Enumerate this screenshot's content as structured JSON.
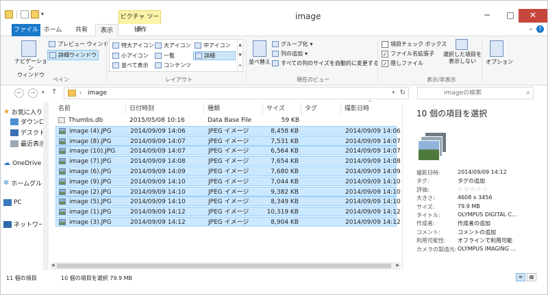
{
  "window": {
    "title": "image",
    "context_tab": "ピクチャ ツール"
  },
  "tabs": {
    "file": "ファイル",
    "home": "ホーム",
    "share": "共有",
    "view": "表示",
    "operate": "操作"
  },
  "ribbon": {
    "pane": {
      "nav_pane": "ナビゲーション\nウィンドウ",
      "preview": "プレビュー ウィンドウ",
      "details": "詳細ウィンドウ",
      "group": "ペイン"
    },
    "layout": {
      "xl_icons": "特大アイコン",
      "l_icons": "大アイコン",
      "m_icons": "中アイコン",
      "s_icons": "小アイコン",
      "list": "一覧",
      "details": "詳細",
      "tiles": "並べて表示",
      "content": "コンテンツ",
      "group": "レイアウト"
    },
    "current_view": {
      "sort": "並べ替え",
      "group_by": "グループ化",
      "add_columns": "列の追加",
      "size_all": "すべての列のサイズを自動的に変更する",
      "group": "現在のビュー"
    },
    "show_hide": {
      "item_checkboxes": "項目チェック ボックス",
      "extensions": "ファイル名拡張子",
      "hidden_items": "隠しファイル",
      "hide_selected": "選択した項目を\n表示しない",
      "group": "表示/非表示"
    },
    "options": "オプション"
  },
  "address": {
    "path": "image",
    "search_placeholder": "imageの検索"
  },
  "nav": {
    "items": [
      {
        "label": "お気に入り"
      },
      {
        "label": "ダウンロード"
      },
      {
        "label": "デスクトップ"
      },
      {
        "label": "最近表示した場所"
      },
      {
        "label": "OneDrive"
      },
      {
        "label": "ホームグループ"
      },
      {
        "label": "PC"
      },
      {
        "label": "ネットワーク"
      }
    ]
  },
  "columns": {
    "name": "名前",
    "date": "日付時刻",
    "type": "種類",
    "size": "サイズ",
    "tag": "タグ",
    "taken": "撮影日時"
  },
  "files": [
    {
      "name": "Thumbs.db",
      "date": "2015/05/08 10:16",
      "type": "Data Base File",
      "size": "59 KB",
      "taken": "",
      "selected": false
    },
    {
      "name": "image (4).JPG",
      "date": "2014/09/09 14:06",
      "type": "JPEG イメージ",
      "size": "8,458 KB",
      "taken": "2014/09/09 14:06",
      "selected": true
    },
    {
      "name": "image (8).JPG",
      "date": "2014/09/09 14:07",
      "type": "JPEG イメージ",
      "size": "7,531 KB",
      "taken": "2014/09/09 14:07",
      "selected": true
    },
    {
      "name": "image (10).JPG",
      "date": "2014/09/09 14:07",
      "type": "JPEG イメージ",
      "size": "6,564 KB",
      "taken": "2014/09/09 14:07",
      "selected": true
    },
    {
      "name": "image (7).JPG",
      "date": "2014/09/09 14:08",
      "type": "JPEG イメージ",
      "size": "7,654 KB",
      "taken": "2014/09/09 14:08",
      "selected": true
    },
    {
      "name": "image (6).JPG",
      "date": "2014/09/09 14:09",
      "type": "JPEG イメージ",
      "size": "7,680 KB",
      "taken": "2014/09/09 14:09",
      "selected": true
    },
    {
      "name": "image (9).JPG",
      "date": "2014/09/09 14:10",
      "type": "JPEG イメージ",
      "size": "7,044 KB",
      "taken": "2014/09/09 14:10",
      "selected": true
    },
    {
      "name": "image (2).JPG",
      "date": "2014/09/09 14:10",
      "type": "JPEG イメージ",
      "size": "9,382 KB",
      "taken": "2014/09/09 14:10",
      "selected": true
    },
    {
      "name": "image (5).JPG",
      "date": "2014/09/09 14:10",
      "type": "JPEG イメージ",
      "size": "8,349 KB",
      "taken": "2014/09/09 14:10",
      "selected": true
    },
    {
      "name": "image (1).JPG",
      "date": "2014/09/09 14:12",
      "type": "JPEG イメージ",
      "size": "10,319 KB",
      "taken": "2014/09/09 14:12",
      "selected": true
    },
    {
      "name": "image (3).JPG",
      "date": "2014/09/09 14:12",
      "type": "JPEG イメージ",
      "size": "8,904 KB",
      "taken": "2014/09/09 14:12",
      "selected": true
    }
  ],
  "details": {
    "title": "10 個の項目を選択",
    "props": [
      {
        "label": "撮影日時:",
        "value": "2014/09/09 14:12"
      },
      {
        "label": "タグ:",
        "value": "タグの追加"
      },
      {
        "label": "評価:",
        "value": "☆☆☆☆☆"
      },
      {
        "label": "大きさ:",
        "value": "4608 x 3456"
      },
      {
        "label": "サイズ:",
        "value": "79.9 MB"
      },
      {
        "label": "タイトル:",
        "value": "OLYMPUS DIGITAL C..."
      },
      {
        "label": "作成者:",
        "value": "作成者の追加"
      },
      {
        "label": "コメント:",
        "value": "コメントの追加"
      },
      {
        "label": "利用可能性:",
        "value": "オフラインで利用可能"
      },
      {
        "label": "カメラの製造元:",
        "value": "OLYMPUS IMAGING ..."
      }
    ]
  },
  "status": {
    "count": "11 個の項目",
    "selected": "10 個の項目を選択 79.9 MB"
  },
  "colors": {
    "accent": "#1979ca",
    "selection": "#cce8ff",
    "close": "#c7463c"
  }
}
